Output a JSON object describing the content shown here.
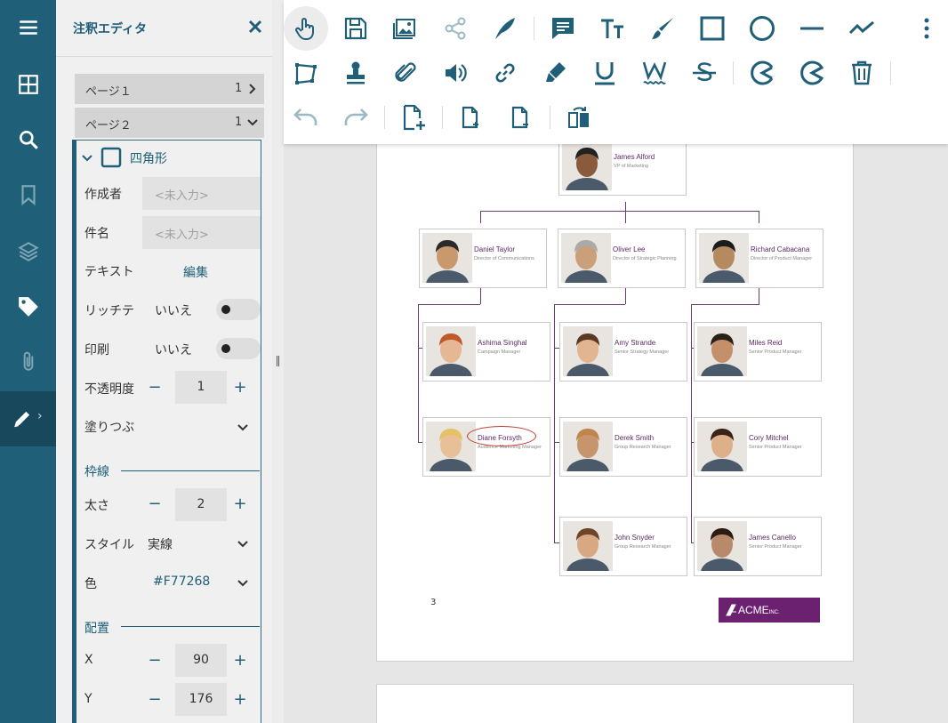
{
  "panel": {
    "title": "注釈エディタ",
    "pages": [
      {
        "label": "ページ１",
        "count": "1",
        "expanded": false
      },
      {
        "label": "ページ２",
        "count": "1",
        "expanded": true
      }
    ],
    "shape": {
      "name": "四角形",
      "author_label": "作成者",
      "author_placeholder": "<未入力>",
      "subject_label": "件名",
      "subject_placeholder": "<未入力>",
      "text_label": "テキスト",
      "text_edit": "編集",
      "rich_label": "リッチテ",
      "rich_value": "いいえ",
      "print_label": "印刷",
      "print_value": "いいえ",
      "opacity_label": "不透明度",
      "opacity_value": "1",
      "fill_label": "塗りつぶ",
      "border_section": "枠線",
      "width_label": "太さ",
      "width_value": "2",
      "style_label": "スタイル",
      "style_value": "実線",
      "color_label": "色",
      "color_value": "#F77268",
      "position_section": "配置",
      "x_label": "X",
      "x_value": "90",
      "y_label": "Y",
      "y_value": "176"
    }
  },
  "rail": {
    "items": [
      "menu-icon",
      "thumbnails-icon",
      "search-icon",
      "bookmark-icon",
      "layers-icon",
      "tag-icon",
      "attachment-icon",
      "pencil-icon"
    ],
    "active": "pencil-icon"
  },
  "toolbar": {
    "row1": [
      "hand-pointer-icon",
      "save-icon",
      "image-icon",
      "share-icon",
      "quill-icon",
      "comment-icon",
      "text-size-icon",
      "brush-icon",
      "square-icon",
      "circle-icon",
      "line-icon",
      "polyline-icon",
      "more-icon"
    ],
    "row2": [
      "polygon-icon",
      "stamp-icon",
      "paperclip-icon",
      "sound-icon",
      "link-icon",
      "highlighter-icon",
      "underline-icon",
      "squiggly-icon",
      "strikeout-icon",
      "arc-icon",
      "pie-icon",
      "trash-icon"
    ],
    "row3": [
      "undo-icon",
      "redo-icon",
      "new-page-icon",
      "insert-page-icon",
      "delete-page-icon",
      "rotate-page-icon"
    ]
  },
  "document": {
    "page_number": "3",
    "logo_text": "ACME",
    "logo_suffix": "INC.",
    "people": [
      {
        "name": "James Alford",
        "role": "VP of Marketing"
      },
      {
        "name": "Daniel Taylor",
        "role": "Director of Communications"
      },
      {
        "name": "Oliver Lee",
        "role": "Director of Strategic Planning"
      },
      {
        "name": "Richard Cabacana",
        "role": "Director of Product Manager"
      },
      {
        "name": "Ashima Singhal",
        "role": "Campaign Manager"
      },
      {
        "name": "Amy Strande",
        "role": "Senior Strategy Manager"
      },
      {
        "name": "Miles Reid",
        "role": "Senior Product Manager"
      },
      {
        "name": "Diane Forsyth",
        "role": "Audience Marketing Manager"
      },
      {
        "name": "Derek Smith",
        "role": "Group Research Manager"
      },
      {
        "name": "Cory Mitchel",
        "role": "Senior Product Manager"
      },
      {
        "name": "John Snyder",
        "role": "Group Research Manager"
      },
      {
        "name": "James Canello",
        "role": "Senior Product Manager"
      }
    ],
    "annotation_color": "#c0392b"
  },
  "colors": {
    "accent": "#205f78",
    "brand": "#6b2070"
  }
}
